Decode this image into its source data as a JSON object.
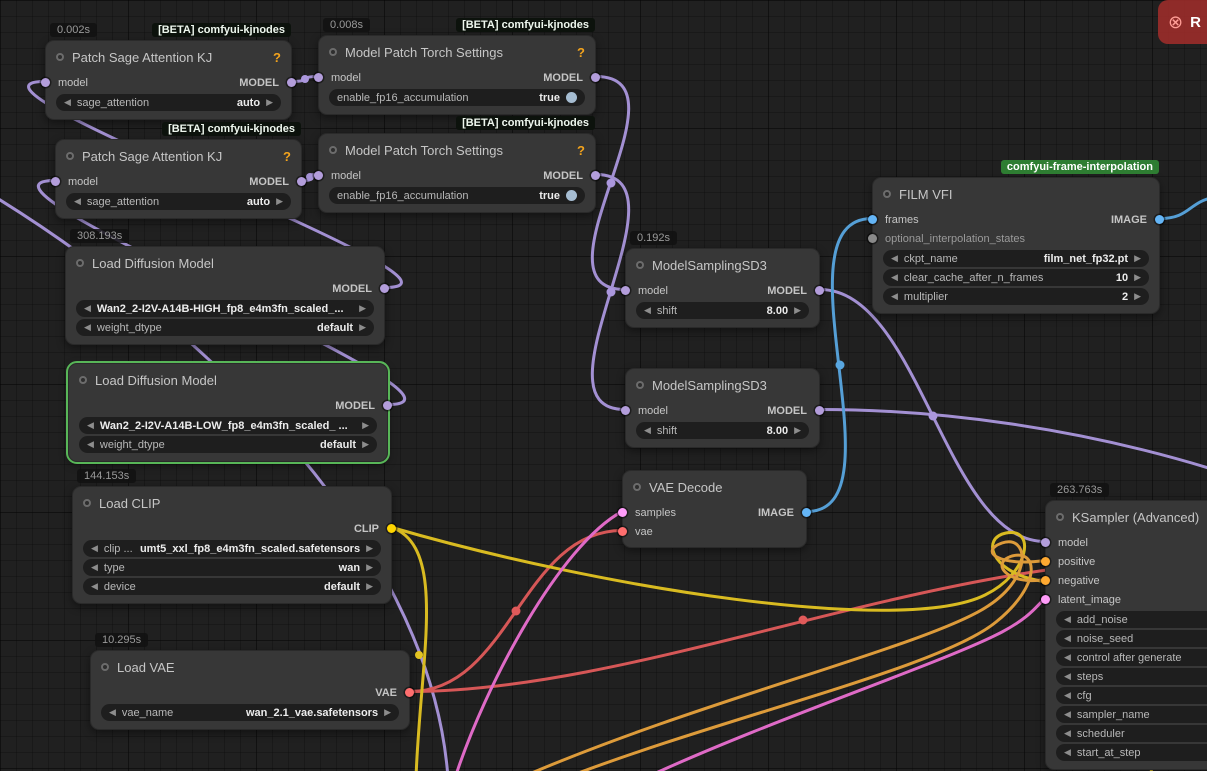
{
  "icons": {
    "combo_left": "◀",
    "combo_right": "▶",
    "circle_x": "⊗"
  },
  "toast": {
    "label": "R"
  },
  "port_colors": {
    "MODEL": "#b39ddb",
    "CLIP": "#ffd500",
    "VAE": "#ff6e6e",
    "IMAGE": "#64b5f6",
    "LATENT": "#ff9cf9",
    "CONDITIONING": "#ffa931",
    "OTHER": "#8a8a8a"
  },
  "link_colors": {
    "model": "#ab97dd",
    "clip": "#e3c422",
    "vae": "#e05a5a",
    "image": "#58a6e0",
    "latent": "#ea6fd0",
    "conditioning": "#e8a23c"
  },
  "nodes": [
    {
      "timer": "0.002s",
      "badge": "[BETA] comfyui-kjnodes",
      "title": "Patch Sage Attention KJ",
      "help": "?",
      "inputs": [
        {
          "name": "model"
        }
      ],
      "outputs": [
        {
          "name": "MODEL"
        }
      ],
      "widgets": [
        {
          "label": "sage_attention",
          "value": "auto"
        }
      ]
    },
    {
      "badge": "[BETA] comfyui-kjnodes",
      "title": "Patch Sage Attention KJ",
      "help": "?",
      "inputs": [
        {
          "name": "model"
        }
      ],
      "outputs": [
        {
          "name": "MODEL"
        }
      ],
      "widgets": [
        {
          "label": "sage_attention",
          "value": "auto"
        }
      ]
    },
    {
      "timer": "0.008s",
      "badge": "[BETA] comfyui-kjnodes",
      "title": "Model Patch Torch Settings",
      "help": "?",
      "inputs": [
        {
          "name": "model"
        }
      ],
      "outputs": [
        {
          "name": "MODEL"
        }
      ],
      "widgets": [
        {
          "label": "enable_fp16_accumulation",
          "value": "true"
        }
      ]
    },
    {
      "badge": "[BETA] comfyui-kjnodes",
      "title": "Model Patch Torch Settings",
      "help": "?",
      "inputs": [
        {
          "name": "model"
        }
      ],
      "outputs": [
        {
          "name": "MODEL"
        }
      ],
      "widgets": [
        {
          "label": "enable_fp16_accumulation",
          "value": "true"
        }
      ]
    },
    {
      "timer": "308.193s",
      "title": "Load Diffusion Model",
      "outputs": [
        {
          "name": "MODEL"
        }
      ],
      "widgets": [
        {
          "value": "Wan2_2-I2V-A14B-HIGH_fp8_e4m3fn_scaled_..."
        },
        {
          "label": "weight_dtype",
          "value": "default"
        }
      ]
    },
    {
      "title": "Load Diffusion Model",
      "outputs": [
        {
          "name": "MODEL"
        }
      ],
      "widgets": [
        {
          "value": "Wan2_2-I2V-A14B-LOW_fp8_e4m3fn_scaled_ ..."
        },
        {
          "label": "weight_dtype",
          "value": "default"
        }
      ]
    },
    {
      "timer": "144.153s",
      "title": "Load CLIP",
      "outputs": [
        {
          "name": "CLIP"
        }
      ],
      "widgets": [
        {
          "label": "clip ...",
          "value": "umt5_xxl_fp8_e4m3fn_scaled.safetensors"
        },
        {
          "label": "type",
          "value": "wan"
        },
        {
          "label": "device",
          "value": "default"
        }
      ]
    },
    {
      "timer": "10.295s",
      "title": "Load VAE",
      "outputs": [
        {
          "name": "VAE"
        }
      ],
      "widgets": [
        {
          "label": "vae_name",
          "value": "wan_2.1_vae.safetensors"
        }
      ]
    },
    {
      "timer": "0.192s",
      "title": "ModelSamplingSD3",
      "inputs": [
        {
          "name": "model"
        }
      ],
      "outputs": [
        {
          "name": "MODEL"
        }
      ],
      "widgets": [
        {
          "label": "shift",
          "value": "8.00"
        }
      ]
    },
    {
      "title": "ModelSamplingSD3",
      "inputs": [
        {
          "name": "model"
        }
      ],
      "outputs": [
        {
          "name": "MODEL"
        }
      ],
      "widgets": [
        {
          "label": "shift",
          "value": "8.00"
        }
      ]
    },
    {
      "title": "VAE Decode",
      "inputs": [
        {
          "name": "samples"
        },
        {
          "name": "vae"
        }
      ],
      "outputs": [
        {
          "name": "IMAGE"
        }
      ]
    },
    {
      "badge": "comfyui-frame-interpolation",
      "title": "FILM VFI",
      "inputs": [
        {
          "name": "frames"
        },
        {
          "name": "optional_interpolation_states"
        }
      ],
      "outputs": [
        {
          "name": "IMAGE"
        }
      ],
      "widgets": [
        {
          "label": "ckpt_name",
          "value": "film_net_fp32.pt"
        },
        {
          "label": "clear_cache_after_n_frames",
          "value": "10"
        },
        {
          "label": "multiplier",
          "value": "2"
        }
      ]
    },
    {
      "timer": "263.763s",
      "title": "KSampler (Advanced)",
      "inputs": [
        {
          "name": "model"
        },
        {
          "name": "positive"
        },
        {
          "name": "negative"
        },
        {
          "name": "latent_image"
        }
      ],
      "widgets": [
        {
          "label": "add_noise"
        },
        {
          "label": "noise_seed"
        },
        {
          "label": "control after generate"
        },
        {
          "label": "steps"
        },
        {
          "label": "cfg"
        },
        {
          "label": "sampler_name"
        },
        {
          "label": "scheduler"
        },
        {
          "label": "start_at_step"
        }
      ]
    }
  ]
}
